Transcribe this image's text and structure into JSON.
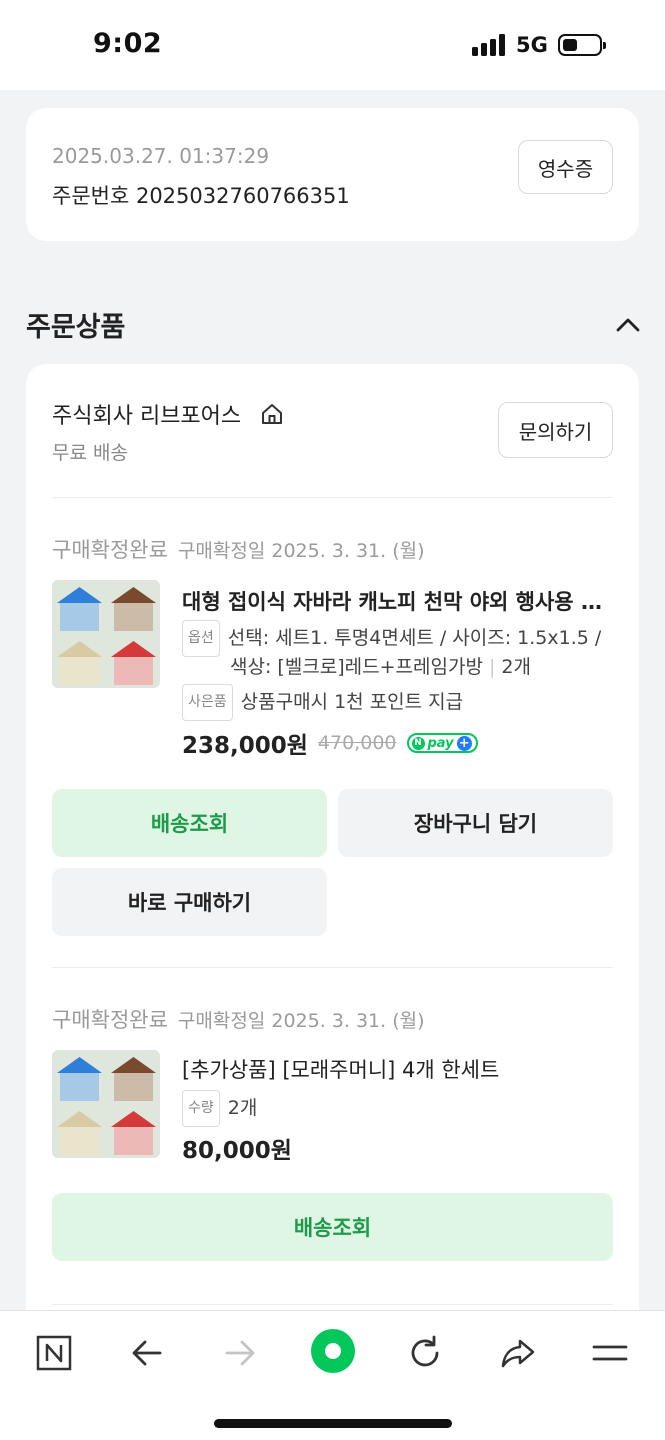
{
  "status_bar": {
    "time": "9:02",
    "network": "5G"
  },
  "order": {
    "datetime": "2025.03.27. 01:37:29",
    "order_number": "주문번호 2025032760766351",
    "receipt_label": "영수증"
  },
  "section": {
    "title": "주문상품"
  },
  "seller": {
    "name": "주식회사 리브포어스",
    "shipping": "무료 배송",
    "inquiry_label": "문의하기"
  },
  "items": [
    {
      "status": "구매확정완료",
      "confirm_date": "구매확정일 2025. 3. 31. (월)",
      "name": "대형 접이식 자바라 캐노피 천막 야외 행사용 몽골텐트",
      "option_tag": "옵션",
      "option_line1": "선택: 세트1. 투명4면세트 / 사이즈: 1.5x1.5 /",
      "option_line2": "색상: [벨크로]레드+프레임가방",
      "quantity": "2개",
      "gift_tag": "사은품",
      "gift": "상품구매시 1천 포인트 지급",
      "price": "238,000원",
      "original_price": "470,000",
      "npay_label": "pay",
      "buttons": {
        "track": "배송조회",
        "cart": "장바구니 담기",
        "buy_again": "바로 구매하기"
      }
    },
    {
      "status": "구매확정완료",
      "confirm_date": "구매확정일 2025. 3. 31. (월)",
      "name": "[추가상품] [모래주머니] 4개 한세트",
      "qty_tag": "수량",
      "quantity": "2개",
      "price": "80,000원",
      "buttons": {
        "track": "배송조회"
      }
    }
  ],
  "colors": {
    "accent_green": "#03c75a",
    "track_button_bg": "#dff6e4",
    "track_button_text": "#1e9b4a",
    "tent_colors": [
      "#2f7fd8",
      "#7a4a2e",
      "#d8cba4",
      "#d43a3a"
    ]
  },
  "bottom_bar": {
    "icons": [
      "naver-home-icon",
      "back-arrow-icon",
      "forward-arrow-icon",
      "green-dot-icon",
      "refresh-icon",
      "share-icon",
      "menu-icon"
    ]
  }
}
